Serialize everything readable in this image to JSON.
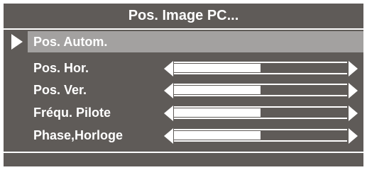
{
  "menu": {
    "title": "Pos. Image PC...",
    "items": [
      {
        "label": "Pos. Autom.",
        "selected": true,
        "has_slider": false
      },
      {
        "label": "Pos. Hor.",
        "selected": false,
        "has_slider": true,
        "value": 0.5
      },
      {
        "label": "Pos. Ver.",
        "selected": false,
        "has_slider": true,
        "value": 0.5
      },
      {
        "label": "Fréqu. Pilote",
        "selected": false,
        "has_slider": true,
        "value": 0.5
      },
      {
        "label": "Phase,Horloge",
        "selected": false,
        "has_slider": true,
        "value": 0.5
      }
    ]
  },
  "colors": {
    "panel_bg": "#5f5b58",
    "highlight_bg": "#a3a1a0",
    "text": "#ffffff"
  },
  "icons": {
    "selection_marker": "triangle-right-icon",
    "decrease": "triangle-left-icon",
    "increase": "triangle-right-icon"
  }
}
